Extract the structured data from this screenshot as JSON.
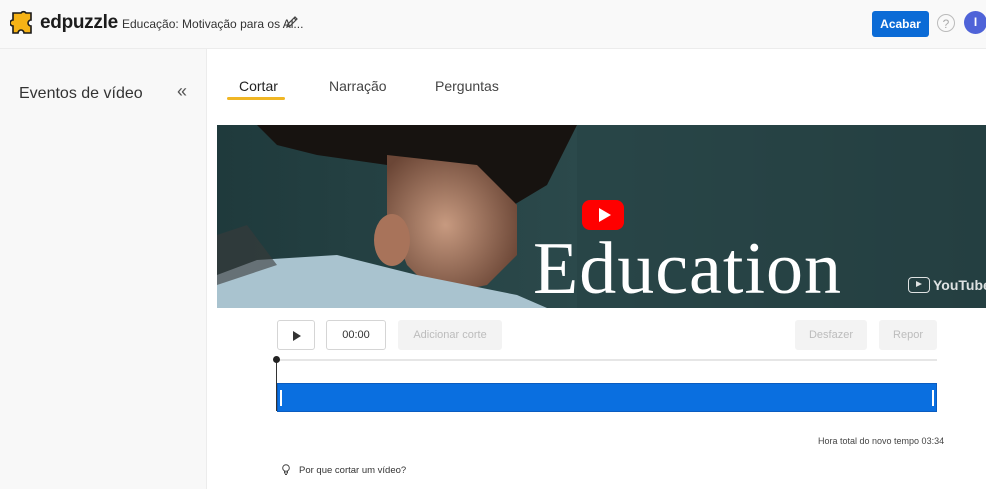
{
  "header": {
    "logo_text": "edpuzzle",
    "doc_title": "Educação: Motivação para os Al...",
    "finish_label": "Acabar",
    "help_glyph": "?",
    "avatar_initial": "I",
    "accent": "#0b6bd6"
  },
  "sidebar": {
    "title": "Eventos de vídeo",
    "collapse_glyph": "«"
  },
  "tabs": [
    {
      "label": "Cortar",
      "active": true
    },
    {
      "label": "Narração",
      "active": false
    },
    {
      "label": "Perguntas",
      "active": false
    }
  ],
  "video": {
    "overlay_word": "Education",
    "yt_label": "YouTube"
  },
  "controls": {
    "time_value": "00:00",
    "add_cut_label": "Adicionar corte",
    "undo_label": "Desfazer",
    "redo_label": "Repor"
  },
  "timeline": {
    "total_time_text": "Hora total do novo tempo 03:34",
    "clip_color": "#0a6fe0"
  },
  "help_link": {
    "label": "Por que cortar um vídeo?"
  }
}
